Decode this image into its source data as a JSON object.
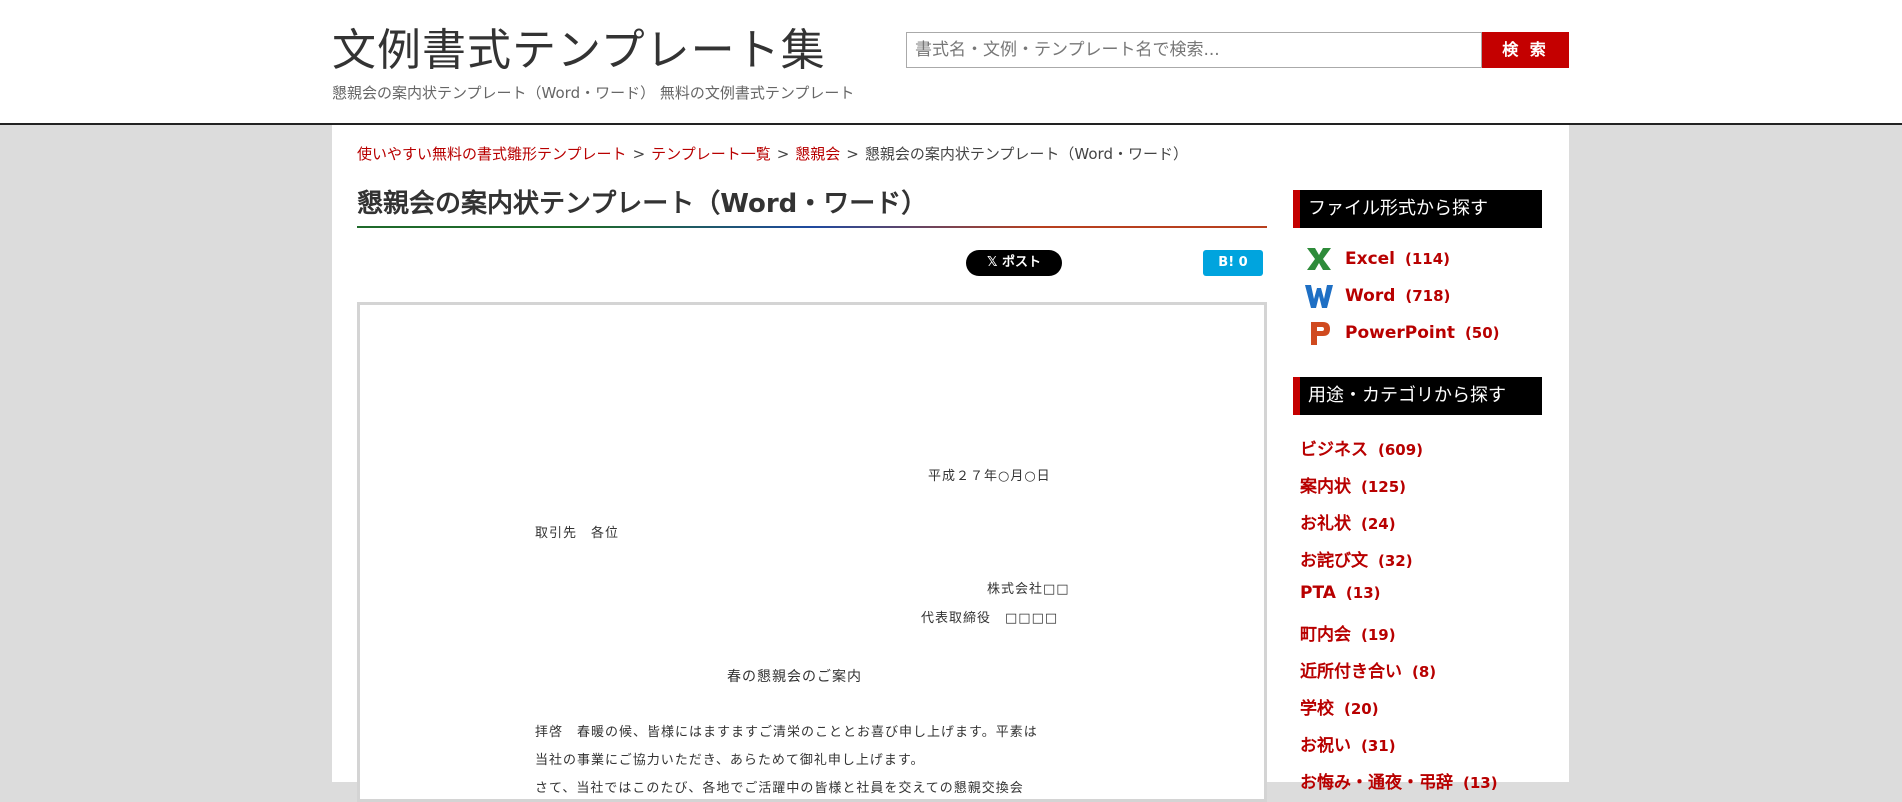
{
  "header": {
    "site_title": "文例書式テンプレート集",
    "subtitle": "懇親会の案内状テンプレート（Word・ワード） 無料の文例書式テンプレート",
    "search_placeholder": "書式名・文例・テンプレート名で検索...",
    "search_button": "検 索"
  },
  "breadcrumb": {
    "items": [
      "使いやすい無料の書式雛形テンプレート",
      "テンプレート一覧",
      "懇親会"
    ],
    "current": "懇親会の案内状テンプレート（Word・ワード）",
    "separator": ">"
  },
  "main": {
    "title": "懇親会の案内状テンプレート（Word・ワード）",
    "x_post_label": "𝕏 ポスト",
    "hatena_label": "B! 0"
  },
  "document": {
    "date": "平成２７年○月○日",
    "recipient": "取引先　各位",
    "company": "株式会社□□",
    "representative": "代表取締役　□□□□",
    "heading": "春の懇親会のご案内",
    "body_line1": "拝啓　春暖の候、皆様にはますますご清栄のこととお喜び申し上げます。平素は",
    "body_line2": "当社の事業にご協力いただき、あらためて御礼申し上げます。",
    "body_line3": "さて、当社ではこのたび、各地でご活躍中の皆様と社員を交えての懇親交換会"
  },
  "sidebar": {
    "format_heading": "ファイル形式から探す",
    "formats": [
      {
        "label": "Excel",
        "count": "(114)",
        "icon": "excel-icon",
        "color": "#2e8b3a"
      },
      {
        "label": "Word",
        "count": "(718)",
        "icon": "word-icon",
        "color": "#1e6fc4"
      },
      {
        "label": "PowerPoint",
        "count": "(50)",
        "icon": "powerpoint-icon",
        "color": "#d04a1f"
      }
    ],
    "category_heading": "用途・カテゴリから探す",
    "categories": [
      {
        "label": "ビジネス",
        "count": "(609)"
      },
      {
        "label": "案内状",
        "count": "(125)"
      },
      {
        "label": "お礼状",
        "count": "(24)"
      },
      {
        "label": "お詫び文",
        "count": "(32)"
      },
      {
        "label": "PTA",
        "count": "(13)"
      },
      {
        "label": "町内会",
        "count": "(19)"
      },
      {
        "label": "近所付き合い",
        "count": "(8)"
      },
      {
        "label": "学校",
        "count": "(20)"
      },
      {
        "label": "お祝い",
        "count": "(31)"
      },
      {
        "label": "お悔み・通夜・弔辞",
        "count": "(13)"
      }
    ]
  },
  "colors": {
    "accent": "#c40000",
    "link": "#b80000"
  }
}
